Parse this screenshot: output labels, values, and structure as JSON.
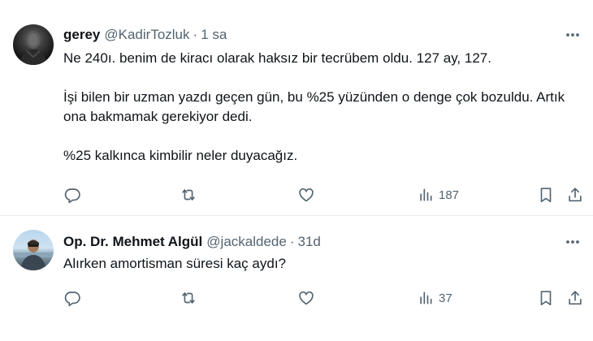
{
  "tweets": [
    {
      "author": {
        "display_name": "gerey",
        "handle": "@KadirTozluk"
      },
      "separator": "·",
      "time": "1 sa",
      "paragraphs": [
        "Ne 240ı. benim de kiracı olarak haksız bir tecrübem oldu. 127 ay, 127.",
        "İşi bilen bir uzman yazdı geçen gün, bu %25 yüzünden o denge çok bozuldu. Artık ona bakmamak gerekiyor dedi.",
        "%25 kalkınca kimbilir neler duyacağız."
      ],
      "actions": {
        "reply_icon": "reply-icon",
        "retweet_icon": "retweet-icon",
        "like_icon": "heart-icon",
        "views_count": "187",
        "bookmark_icon": "bookmark-icon",
        "share_icon": "share-icon"
      }
    },
    {
      "author": {
        "display_name": "Op. Dr. Mehmet Algül",
        "handle": "@jackaldede"
      },
      "separator": "·",
      "time": "31d",
      "paragraphs": [
        "Alırken amortisman süresi kaç aydı?"
      ],
      "actions": {
        "reply_icon": "reply-icon",
        "retweet_icon": "retweet-icon",
        "like_icon": "heart-icon",
        "views_count": "37",
        "bookmark_icon": "bookmark-icon",
        "share_icon": "share-icon"
      }
    }
  ],
  "colors": {
    "text": "#0f1419",
    "secondary": "#536471",
    "divider": "#e6e9eb"
  }
}
